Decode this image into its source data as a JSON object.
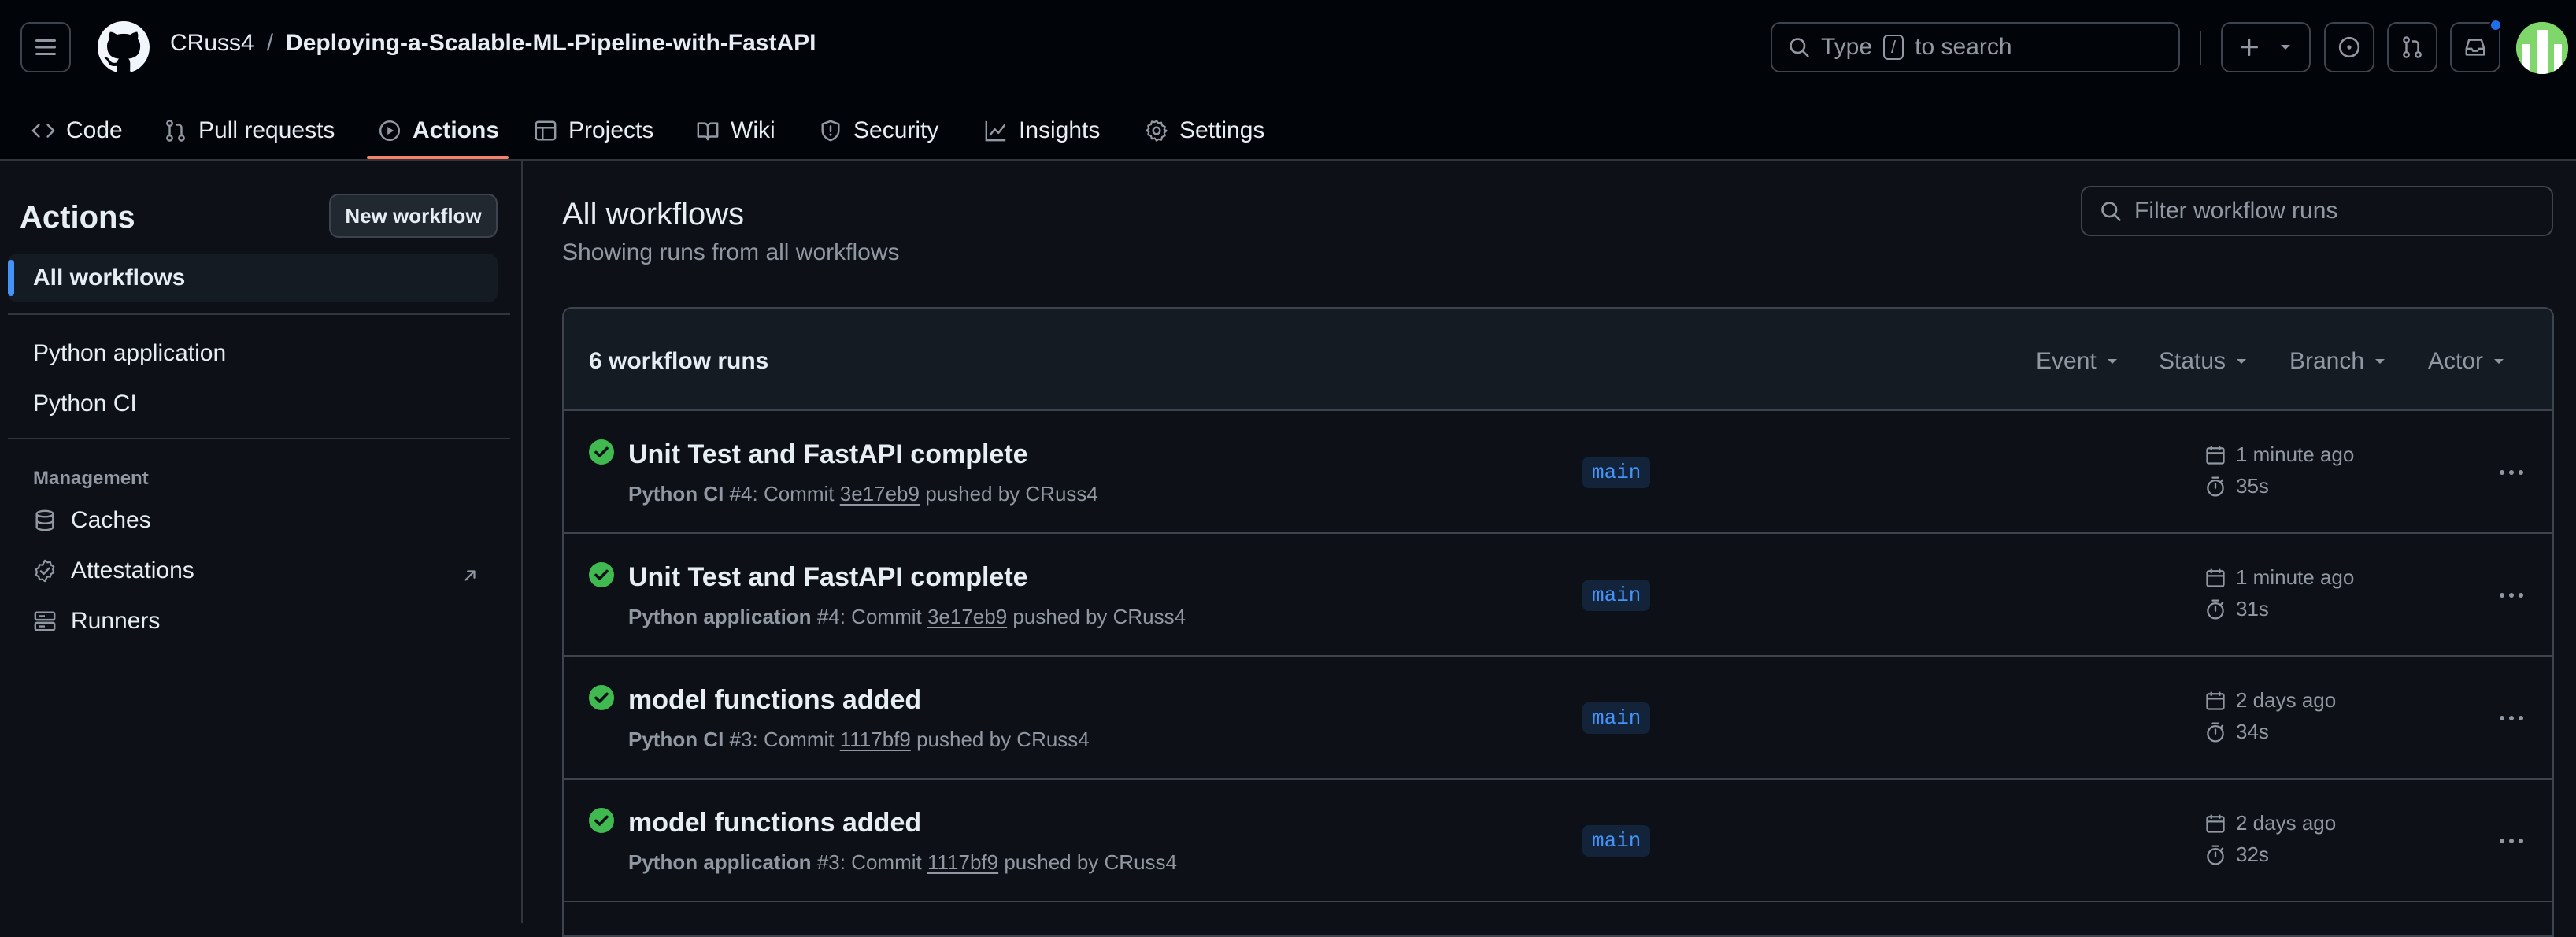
{
  "header": {
    "owner": "CRuss4",
    "separator": "/",
    "repo": "Deploying-a-Scalable-ML-Pipeline-with-FastAPI",
    "search_prefix": "Type",
    "search_key": "/",
    "search_suffix": "to search"
  },
  "tabs": [
    {
      "label": "Code",
      "icon": "code-icon"
    },
    {
      "label": "Pull requests",
      "icon": "git-pull-request-icon"
    },
    {
      "label": "Actions",
      "icon": "play-icon"
    },
    {
      "label": "Projects",
      "icon": "table-icon"
    },
    {
      "label": "Wiki",
      "icon": "book-icon"
    },
    {
      "label": "Security",
      "icon": "shield-icon"
    },
    {
      "label": "Insights",
      "icon": "graph-icon"
    },
    {
      "label": "Settings",
      "icon": "gear-icon"
    }
  ],
  "sidebar": {
    "title": "Actions",
    "new_workflow": "New workflow",
    "all_workflows": "All workflows",
    "workflows": [
      "Python application",
      "Python CI"
    ],
    "management_label": "Management",
    "management": [
      {
        "label": "Caches",
        "icon": "database-icon"
      },
      {
        "label": "Attestations",
        "icon": "verified-icon"
      },
      {
        "label": "Runners",
        "icon": "server-icon"
      }
    ]
  },
  "main": {
    "title": "All workflows",
    "subtitle": "Showing runs from all workflows",
    "filter_placeholder": "Filter workflow runs",
    "runs_count": "6 workflow runs",
    "filters": [
      "Event",
      "Status",
      "Branch",
      "Actor"
    ]
  },
  "runs": [
    {
      "title": "Unit Test and FastAPI complete",
      "workflow": "Python CI",
      "run": "#4",
      "mid": ": Commit ",
      "commit": "3e17eb9",
      "pushed": " pushed by CRuss4",
      "branch": "main",
      "when": "1 minute ago",
      "duration": "35s",
      "status": "success"
    },
    {
      "title": "Unit Test and FastAPI complete",
      "workflow": "Python application",
      "run": "#4",
      "mid": ": Commit ",
      "commit": "3e17eb9",
      "pushed": " pushed by CRuss4",
      "branch": "main",
      "when": "1 minute ago",
      "duration": "31s",
      "status": "success"
    },
    {
      "title": "model functions added",
      "workflow": "Python CI",
      "run": "#3",
      "mid": ": Commit ",
      "commit": "1117bf9",
      "pushed": " pushed by CRuss4",
      "branch": "main",
      "when": "2 days ago",
      "duration": "34s",
      "status": "success"
    },
    {
      "title": "model functions added",
      "workflow": "Python application",
      "run": "#3",
      "mid": ": Commit ",
      "commit": "1117bf9",
      "pushed": " pushed by CRuss4",
      "branch": "main",
      "when": "2 days ago",
      "duration": "32s",
      "status": "success"
    }
  ],
  "colors": {
    "background": "#0d1117",
    "header": "#010409",
    "accent": "#4493f8",
    "success": "#3fb950",
    "tab_underline": "#f78166"
  }
}
